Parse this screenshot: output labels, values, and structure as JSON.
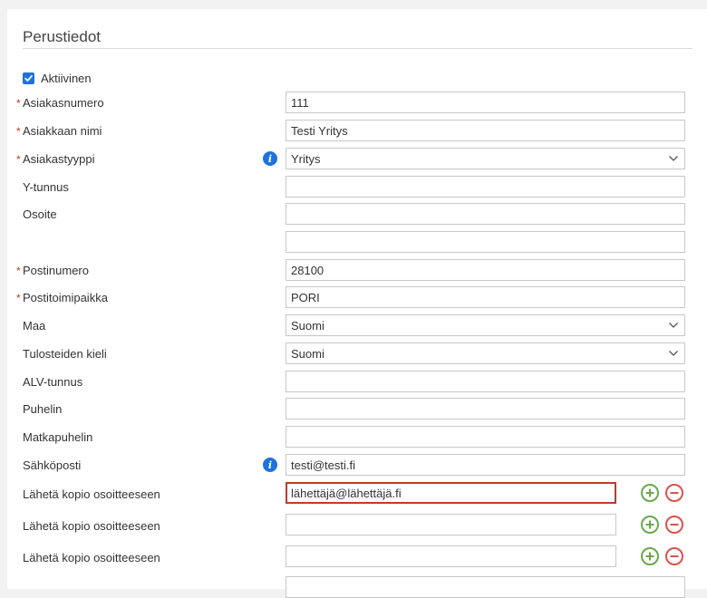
{
  "section": {
    "title": "Perustiedot"
  },
  "active": {
    "label": "Aktiivinen",
    "checked": true
  },
  "fields": {
    "customer_number": {
      "label": "Asiakasnumero",
      "required_mark": "*",
      "value": "111"
    },
    "customer_name": {
      "label": "Asiakkaan nimi",
      "required_mark": "*",
      "value": "Testi Yritys"
    },
    "customer_type": {
      "label": "Asiakastyyppi",
      "required_mark": "*",
      "value": "Yritys"
    },
    "business_id": {
      "label": "Y-tunnus",
      "value": ""
    },
    "address": {
      "label": "Osoite",
      "value": "",
      "value2": ""
    },
    "postal_code": {
      "label": "Postinumero",
      "required_mark": "*",
      "value": "28100"
    },
    "city": {
      "label": "Postitoimipaikka",
      "required_mark": "*",
      "value": "PORI"
    },
    "country": {
      "label": "Maa",
      "value": "Suomi"
    },
    "print_language": {
      "label": "Tulosteiden kieli",
      "value": "Suomi"
    },
    "vat_id": {
      "label": "ALV-tunnus",
      "value": ""
    },
    "phone": {
      "label": "Puhelin",
      "value": ""
    },
    "mobile": {
      "label": "Matkapuhelin",
      "value": ""
    },
    "email": {
      "label": "Sähköposti",
      "value": "testi@testi.fi"
    },
    "copy_email_1": {
      "label": "Lähetä kopio osoitteeseen",
      "value": "lähettäjä@lähettäjä.fi"
    },
    "copy_email_2": {
      "label": "Lähetä kopio osoitteeseen",
      "value": ""
    },
    "copy_email_3": {
      "label": "Lähetä kopio osoitteeseen",
      "value": ""
    }
  },
  "icons": {
    "info": "info-icon",
    "checkbox": "checkmark-icon",
    "dropdown": "chevron-down-icon",
    "add": "plus-circle-icon",
    "remove": "minus-circle-icon"
  },
  "colors": {
    "accent": "#1e73d8",
    "required": "#c0392b",
    "error_border": "#c0392b",
    "add": "#6aa84f",
    "remove": "#d9534f"
  }
}
